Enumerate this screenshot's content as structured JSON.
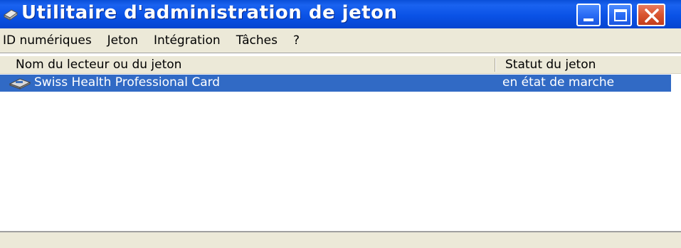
{
  "window": {
    "title": "Utilitaire d'administration de jeton",
    "app_icon": "smartcard-reader-icon",
    "controls": {
      "minimize_icon": "minimize-icon",
      "maximize_icon": "maximize-icon",
      "close_icon": "close-icon"
    }
  },
  "menu": {
    "items": [
      {
        "label": "ID numériques"
      },
      {
        "label": "Jeton"
      },
      {
        "label": "Intégration"
      },
      {
        "label": "Tâches"
      },
      {
        "label": "?"
      }
    ]
  },
  "list": {
    "columns": [
      {
        "label": "Nom du lecteur ou du jeton"
      },
      {
        "label": "Statut du jeton"
      }
    ],
    "rows": [
      {
        "icon": "smartcard-reader-icon",
        "name": "Swiss Health Professional Card",
        "status": "en état de marche",
        "selected": true
      }
    ]
  },
  "colors": {
    "titlebar": "#0a52e6",
    "selection": "#316ac5",
    "chrome": "#ece9d8",
    "close_button": "#d9542f"
  }
}
